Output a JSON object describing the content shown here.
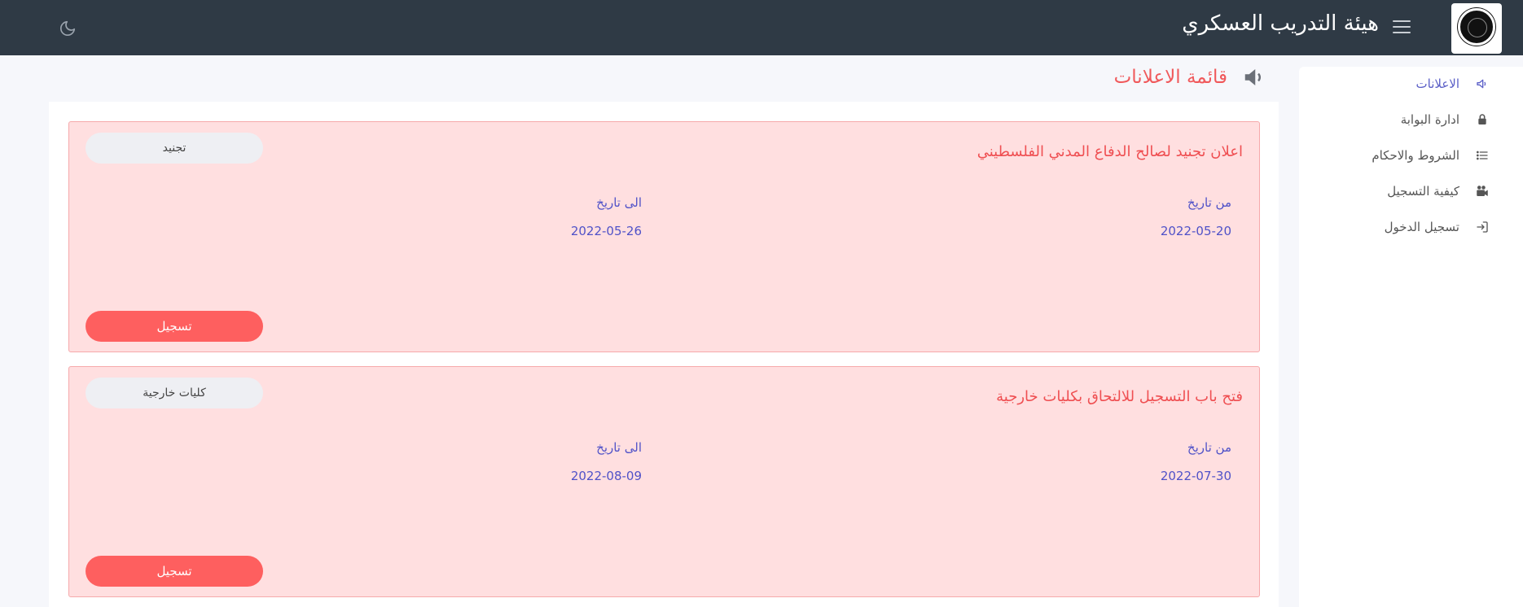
{
  "header": {
    "title": "هيئة التدريب العسكري",
    "menu_icon": "hamburger-icon",
    "theme_icon": "moon-icon"
  },
  "sidebar": {
    "items": [
      {
        "label": "الاعلانات",
        "icon": "megaphone-icon",
        "active": true
      },
      {
        "label": "ادارة البوابة",
        "icon": "lock-icon",
        "active": false
      },
      {
        "label": "الشروط والاحكام",
        "icon": "list-icon",
        "active": false
      },
      {
        "label": "كيفية التسجيل",
        "icon": "video-camera-icon",
        "active": false
      },
      {
        "label": "تسجيل الدخول",
        "icon": "sign-in-icon",
        "active": false
      }
    ]
  },
  "page": {
    "title": "قائمة الاعلانات",
    "icon": "megaphone-icon"
  },
  "announcements": [
    {
      "title": "اعلان تجنيد لصالح الدفاع المدني الفلسطيني",
      "tag": "تجنيد",
      "from_label": "من تاريخ",
      "from_date": "2022-05-20",
      "to_label": "الى تاريخ",
      "to_date": "2022-05-26",
      "register_label": "تسجيل"
    },
    {
      "title": "فتح باب التسجيل للالتحاق بكليات خارجية",
      "tag": "كليات خارجية",
      "from_label": "من تاريخ",
      "from_date": "2022-07-30",
      "to_label": "الى تاريخ",
      "to_date": "2022-08-09",
      "register_label": "تسجيل"
    }
  ],
  "colors": {
    "header_bg": "#2f3a45",
    "accent_red": "#fe5f5f",
    "card_bg": "#ffdfe0",
    "date_blue": "#5052c8",
    "active_nav": "#5b5fc7"
  }
}
